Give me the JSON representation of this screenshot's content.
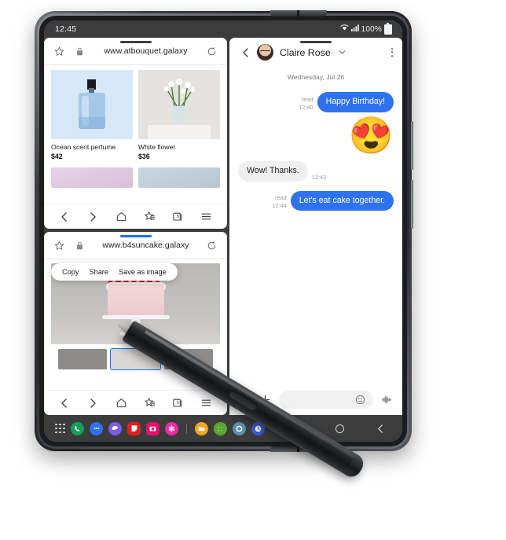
{
  "statusbar": {
    "time": "12:45",
    "battery_text": "100%",
    "icons": [
      "wifi-icon",
      "signal-icon",
      "battery-icon"
    ]
  },
  "browser_top": {
    "url": "www.atbouquet.galaxy",
    "icons": {
      "star": "star-icon",
      "lock": "lock-icon",
      "reload": "reload-icon"
    },
    "products": [
      {
        "name": "Ocean scent perfume",
        "price": "$42"
      },
      {
        "name": "White flower",
        "price": "$36"
      }
    ],
    "nav": {
      "back": "back-icon",
      "forward": "forward-icon",
      "home": "home-icon",
      "bookmarks": "bookmarks-icon",
      "tabs": "tabs-icon",
      "tabs_count": "5",
      "menu": "menu-icon"
    }
  },
  "browser_bottom": {
    "url": "www.b4suncake.galaxy",
    "icons": {
      "star": "star-icon",
      "lock": "lock-icon",
      "reload": "reload-icon"
    },
    "context_menu": {
      "items": [
        "Copy",
        "Share",
        "Save as image"
      ]
    },
    "nav": {
      "back": "back-icon",
      "forward": "forward-icon",
      "home": "home-icon",
      "bookmarks": "bookmarks-icon",
      "tabs": "tabs-icon",
      "tabs_count": "5",
      "menu": "menu-icon"
    }
  },
  "messages": {
    "header": {
      "back": "back-icon",
      "contact": "Claire Rose",
      "chevron": "chevron-down-icon",
      "more": "more-options-icon"
    },
    "date_separator": "Wednesday, Jul 26",
    "items": [
      {
        "dir": "out",
        "text": "Happy Birthday!",
        "status": "read",
        "time": "12:40"
      },
      {
        "dir": "out",
        "emoji": "😍"
      },
      {
        "dir": "in",
        "text": "Wow! Thanks.",
        "time": "12:43"
      },
      {
        "dir": "out",
        "text": "Let's eat cake together.",
        "status": "read",
        "time": "12:44"
      }
    ],
    "composer": {
      "placeholder": "",
      "value": "",
      "icons": [
        "image-icon",
        "add-icon",
        "emoji-icon",
        "voice-icon"
      ]
    },
    "accent_color": "#2f72f0",
    "bubble_in_color": "#efefef"
  },
  "taskbar": {
    "apps_button": "apps-grid-icon",
    "apps": [
      {
        "name": "phone-app-icon",
        "color": "#15a05a",
        "glyph": "✆"
      },
      {
        "name": "messages-app-icon",
        "color": "#2f72f0",
        "glyph": "●●"
      },
      {
        "name": "internet-app-icon",
        "color": "#7b5cf0",
        "glyph": "◑"
      },
      {
        "name": "notes-app-icon",
        "color": "#e02020",
        "glyph": "◧"
      },
      {
        "name": "camera-app-icon",
        "color": "#e5106b",
        "glyph": "◉"
      },
      {
        "name": "photos-app-icon",
        "color": "#ef2aa6",
        "glyph": "✱"
      },
      {
        "name": "files-app-icon",
        "color": "#f5a623",
        "glyph": "▭"
      },
      {
        "name": "calculator-app-icon",
        "color": "#5aa832",
        "glyph": "±"
      },
      {
        "name": "settings-app-icon",
        "color": "#5b8fb0",
        "glyph": "⚙"
      },
      {
        "name": "clock-app-icon",
        "color": "#3b5bdb",
        "glyph": "◴"
      }
    ],
    "sysnav": {
      "recents": "recents-icon",
      "home": "home-icon",
      "back": "back-icon"
    }
  },
  "device": {
    "stylus": "s-pen-stylus"
  }
}
